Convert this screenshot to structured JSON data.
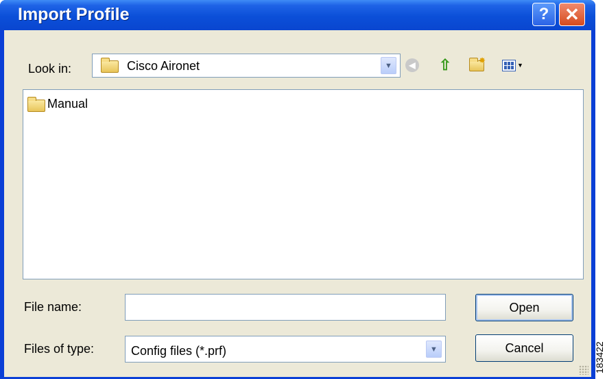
{
  "window": {
    "title": "Import Profile",
    "help_glyph": "?",
    "close_glyph": "✕"
  },
  "toolbar": {
    "look_in_label": "Look in:",
    "look_in_value": "Cisco Aironet",
    "icons": [
      "folder-icon",
      "back-icon",
      "up-folder-icon",
      "new-folder-icon",
      "views-menu-icon"
    ]
  },
  "file_list": {
    "items": [
      {
        "name": "Manual",
        "icon": "folder-icon"
      }
    ]
  },
  "footer": {
    "file_name_label": "File name:",
    "file_name_value": "",
    "files_of_type_label": "Files of type:",
    "files_of_type_value": "Config files (*.prf)",
    "open_label": "Open",
    "cancel_label": "Cancel"
  },
  "figure_number": "183422",
  "colors": {
    "titlebar": "#0a46d0",
    "dialog_bg": "#ece9d8",
    "close_button": "#d54b1e",
    "border": "#7f9db9"
  }
}
